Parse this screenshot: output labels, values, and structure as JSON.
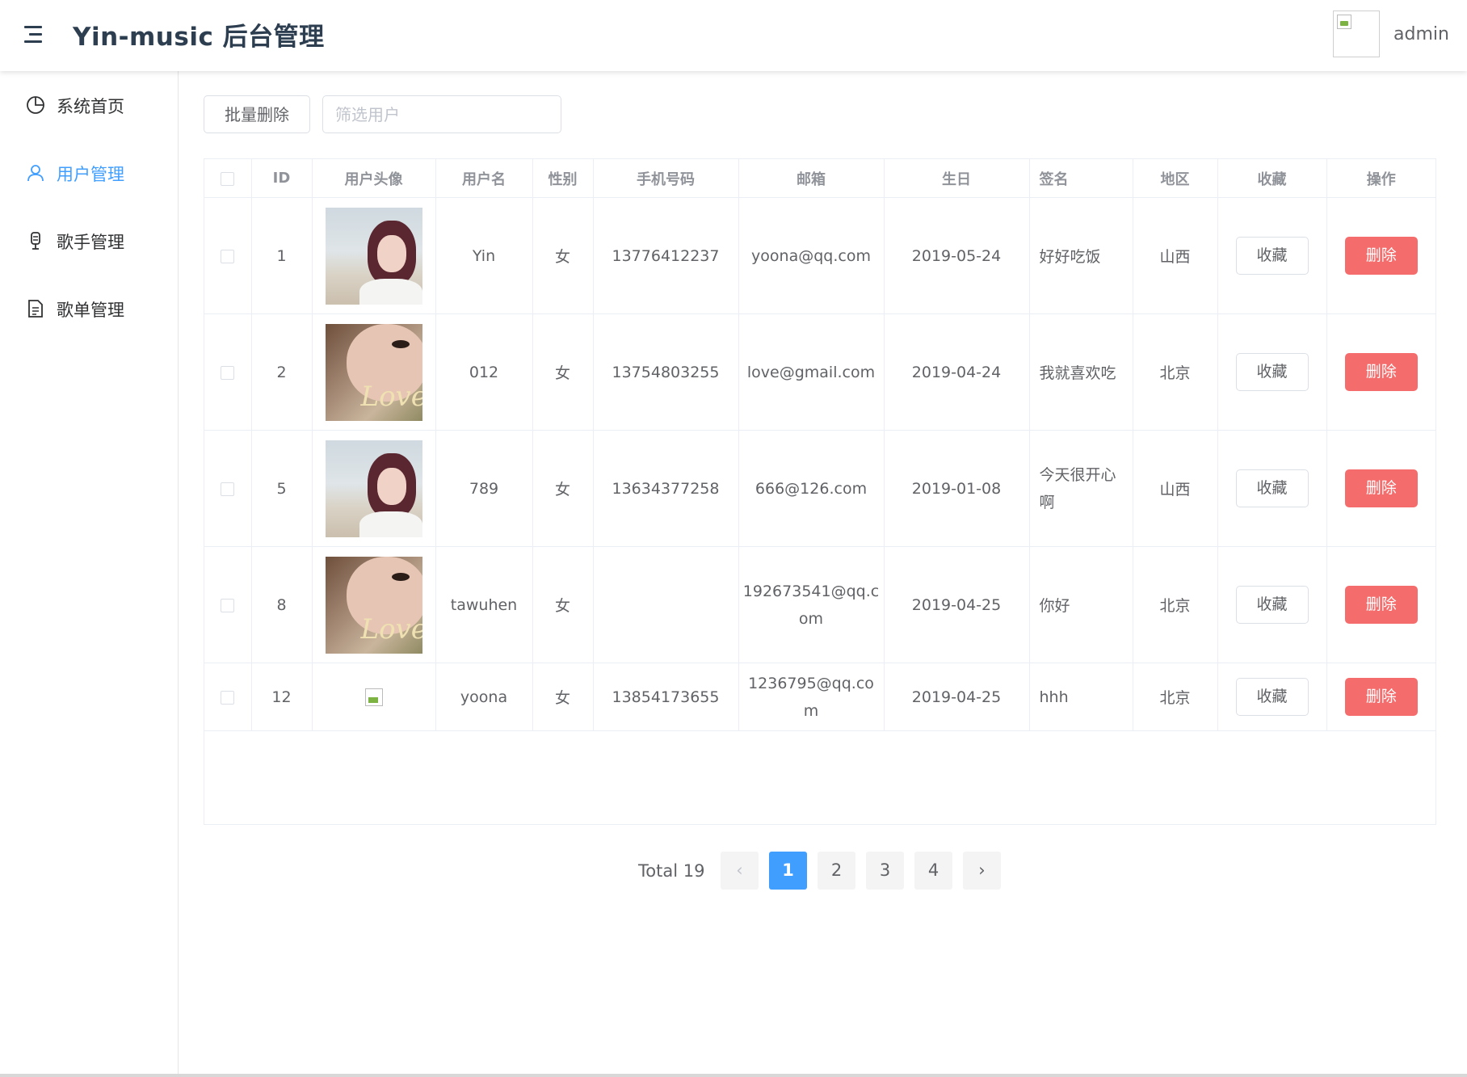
{
  "header": {
    "title": "Yin-music 后台管理",
    "username": "admin"
  },
  "sidebar": {
    "items": [
      {
        "label": "系统首页",
        "icon": "pie-chart-icon",
        "active": false
      },
      {
        "label": "用户管理",
        "icon": "user-icon",
        "active": true
      },
      {
        "label": "歌手管理",
        "icon": "microphone-icon",
        "active": false
      },
      {
        "label": "歌单管理",
        "icon": "document-icon",
        "active": false
      }
    ]
  },
  "toolbar": {
    "batch_delete_label": "批量删除",
    "filter_placeholder": "筛选用户",
    "filter_value": ""
  },
  "table": {
    "columns": [
      "ID",
      "用户头像",
      "用户名",
      "性别",
      "手机号码",
      "邮箱",
      "生日",
      "签名",
      "地区",
      "收藏",
      "操作"
    ],
    "collect_label": "收藏",
    "delete_label": "删除",
    "rows": [
      {
        "id": "1",
        "avatar": "beach-photo",
        "username": "Yin",
        "gender": "女",
        "phone": "13776412237",
        "email": "yoona@qq.com",
        "birthday": "2019-05-24",
        "signature": "好好吃饭",
        "region": "山西"
      },
      {
        "id": "2",
        "avatar": "love-photo",
        "username": "012",
        "gender": "女",
        "phone": "13754803255",
        "email": "love@gmail.com",
        "birthday": "2019-04-24",
        "signature": "我就喜欢吃",
        "region": "北京"
      },
      {
        "id": "5",
        "avatar": "beach-photo",
        "username": "789",
        "gender": "女",
        "phone": "13634377258",
        "email": "666@126.com",
        "birthday": "2019-01-08",
        "signature": "今天很开心啊",
        "region": "山西"
      },
      {
        "id": "8",
        "avatar": "love-photo",
        "username": "tawuhen",
        "gender": "女",
        "phone": "",
        "email": "192673541@qq.com",
        "birthday": "2019-04-25",
        "signature": "你好",
        "region": "北京"
      },
      {
        "id": "12",
        "avatar": "broken-image",
        "username": "yoona",
        "gender": "女",
        "phone": "13854173655",
        "email": "1236795@qq.com",
        "birthday": "2019-04-25",
        "signature": "hhh",
        "region": "北京"
      }
    ]
  },
  "pagination": {
    "total_label": "Total 19",
    "pages": [
      "1",
      "2",
      "3",
      "4"
    ],
    "current": "1",
    "prev": "‹",
    "next": "›"
  }
}
